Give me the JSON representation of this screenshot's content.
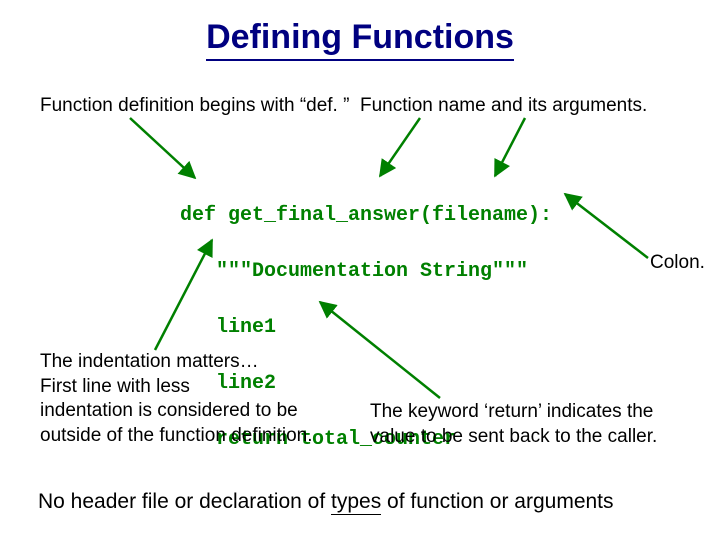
{
  "title": "Defining Functions",
  "labels": {
    "def_begins": "Function definition begins with “def. ”",
    "name_args": "Function name and its arguments.",
    "colon": "Colon.",
    "indent": "The indentation matters…\nFirst line with less\nindentation is considered to be\noutside of the function definition.",
    "return": "The keyword ‘return’ indicates the\nvalue to be sent back to the caller."
  },
  "code": {
    "l1": "def get_final_answer(filename):",
    "l2": "   \"\"\"Documentation String\"\"\"",
    "l3": "   line1",
    "l4": "   line2",
    "l5": "   return total_counter"
  },
  "footer": {
    "pre": "No header file or declaration of ",
    "u": "types",
    "post": " of function or arguments"
  }
}
